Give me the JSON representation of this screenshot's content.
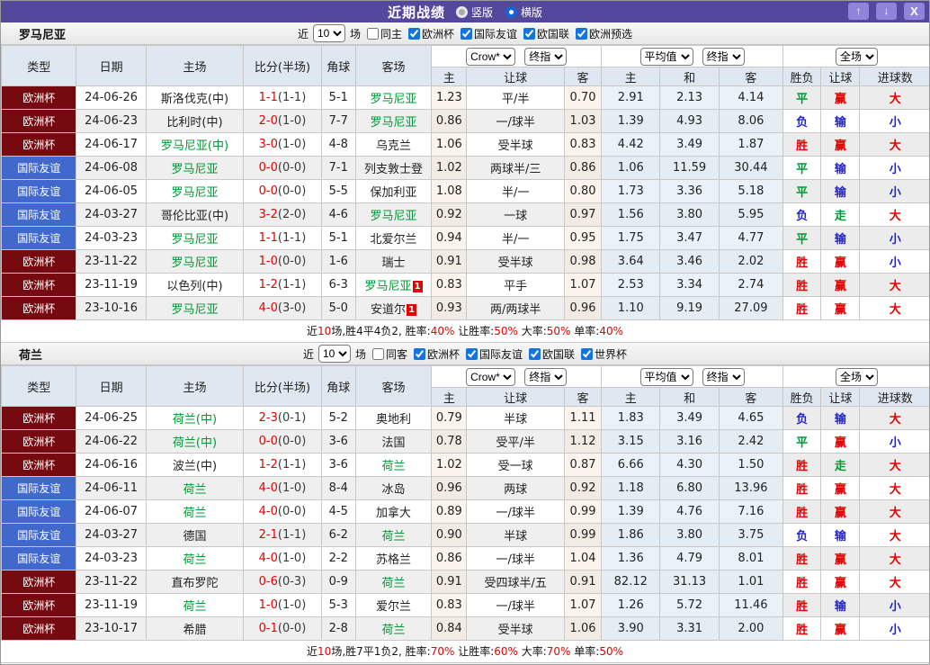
{
  "titlebar": {
    "title": "近期战绩",
    "radios": [
      {
        "label": "竖版",
        "selected": false
      },
      {
        "label": "横版",
        "selected": true
      }
    ],
    "buttons": {
      "up": "↑",
      "down": "↓",
      "close": "X"
    },
    "accent": "#54489C"
  },
  "labels": {
    "type": "类型",
    "date": "日期",
    "home": "主场",
    "score": "比分(半场)",
    "corner": "角球",
    "away": "客场",
    "odds_home": "主",
    "handicap": "让球",
    "odds_away": "客",
    "avg_home": "主",
    "avg_draw": "和",
    "avg_away": "客",
    "result": "胜负",
    "let_result": "让球",
    "goals": "进球数",
    "near": "近",
    "games": "场"
  },
  "colors": {
    "win": "#E60000",
    "draw": "#009933",
    "lose": "#2323CC",
    "cup_badge": "#750A10",
    "friendly_badge": "#4169CD",
    "self_team": "#009933"
  },
  "sections": [
    {
      "team": "罗马尼亚",
      "filter": {
        "count": "10",
        "same": "同主",
        "leagues": [
          "欧洲杯",
          "国际友谊",
          "欧国联",
          "欧洲预选"
        ]
      },
      "selects": {
        "crow": "Crow*",
        "crow_fin": "终指",
        "avg": "平均值",
        "avg_fin": "终指",
        "scope": "全场"
      },
      "rows": [
        {
          "league": "欧洲杯",
          "lt": "cup",
          "date": "24-06-26",
          "home": "斯洛伐克(中)",
          "hs": false,
          "score": "1-1",
          "half": "(1-1)",
          "corners": "5-1",
          "away": "罗马尼亚",
          "as": true,
          "card": "",
          "odds": [
            "1.23",
            "平/半",
            "0.70",
            "2.91",
            "2.13",
            "4.14"
          ],
          "results": [
            "平",
            "赢",
            "大"
          ]
        },
        {
          "league": "欧洲杯",
          "lt": "cup",
          "date": "24-06-23",
          "home": "比利时(中)",
          "hs": false,
          "score": "2-0",
          "half": "(1-0)",
          "corners": "7-7",
          "away": "罗马尼亚",
          "as": true,
          "card": "",
          "odds": [
            "0.86",
            "一/球半",
            "1.03",
            "1.39",
            "4.93",
            "8.06"
          ],
          "results": [
            "负",
            "输",
            "小"
          ]
        },
        {
          "league": "欧洲杯",
          "lt": "cup",
          "date": "24-06-17",
          "home": "罗马尼亚(中)",
          "hs": true,
          "score": "3-0",
          "half": "(1-0)",
          "corners": "4-8",
          "away": "乌克兰",
          "as": false,
          "card": "",
          "odds": [
            "1.06",
            "受半球",
            "0.83",
            "4.42",
            "3.49",
            "1.87"
          ],
          "results": [
            "胜",
            "赢",
            "大"
          ]
        },
        {
          "league": "国际友谊",
          "lt": "fr",
          "date": "24-06-08",
          "home": "罗马尼亚",
          "hs": true,
          "score": "0-0",
          "half": "(0-0)",
          "corners": "7-1",
          "away": "列支敦士登",
          "as": false,
          "card": "",
          "odds": [
            "1.02",
            "两球半/三",
            "0.86",
            "1.06",
            "11.59",
            "30.44"
          ],
          "results": [
            "平",
            "输",
            "小"
          ]
        },
        {
          "league": "国际友谊",
          "lt": "fr",
          "date": "24-06-05",
          "home": "罗马尼亚",
          "hs": true,
          "score": "0-0",
          "half": "(0-0)",
          "corners": "5-5",
          "away": "保加利亚",
          "as": false,
          "card": "",
          "odds": [
            "1.08",
            "半/一",
            "0.80",
            "1.73",
            "3.36",
            "5.18"
          ],
          "results": [
            "平",
            "输",
            "小"
          ]
        },
        {
          "league": "国际友谊",
          "lt": "fr",
          "date": "24-03-27",
          "home": "哥伦比亚(中)",
          "hs": false,
          "score": "3-2",
          "half": "(2-0)",
          "corners": "4-6",
          "away": "罗马尼亚",
          "as": true,
          "card": "",
          "odds": [
            "0.92",
            "一球",
            "0.97",
            "1.56",
            "3.80",
            "5.95"
          ],
          "results": [
            "负",
            "走",
            "大"
          ]
        },
        {
          "league": "国际友谊",
          "lt": "fr",
          "date": "24-03-23",
          "home": "罗马尼亚",
          "hs": true,
          "score": "1-1",
          "half": "(1-1)",
          "corners": "5-1",
          "away": "北爱尔兰",
          "as": false,
          "card": "",
          "odds": [
            "0.94",
            "半/一",
            "0.95",
            "1.75",
            "3.47",
            "4.77"
          ],
          "results": [
            "平",
            "输",
            "小"
          ]
        },
        {
          "league": "欧洲杯",
          "lt": "cup",
          "date": "23-11-22",
          "home": "罗马尼亚",
          "hs": true,
          "score": "1-0",
          "half": "(0-0)",
          "corners": "1-6",
          "away": "瑞士",
          "as": false,
          "card": "",
          "odds": [
            "0.91",
            "受半球",
            "0.98",
            "3.64",
            "3.46",
            "2.02"
          ],
          "results": [
            "胜",
            "赢",
            "小"
          ]
        },
        {
          "league": "欧洲杯",
          "lt": "cup",
          "date": "23-11-19",
          "home": "以色列(中)",
          "hs": false,
          "score": "1-2",
          "half": "(1-1)",
          "corners": "6-3",
          "away": "罗马尼亚",
          "as": true,
          "card": "1",
          "odds": [
            "0.83",
            "平手",
            "1.07",
            "2.53",
            "3.34",
            "2.74"
          ],
          "results": [
            "胜",
            "赢",
            "大"
          ]
        },
        {
          "league": "欧洲杯",
          "lt": "cup",
          "date": "23-10-16",
          "home": "罗马尼亚",
          "hs": true,
          "score": "4-0",
          "half": "(3-0)",
          "corners": "5-0",
          "away": "安道尔",
          "as": false,
          "card": "1",
          "odds": [
            "0.93",
            "两/两球半",
            "0.96",
            "1.10",
            "9.19",
            "27.09"
          ],
          "results": [
            "胜",
            "赢",
            "大"
          ]
        }
      ],
      "summary": [
        {
          "t": "近",
          "red": false
        },
        {
          "t": "10",
          "red": true
        },
        {
          "t": "场,胜4平4负2, 胜率:",
          "red": false
        },
        {
          "t": "40%",
          "red": true
        },
        {
          "t": " 让胜率:",
          "red": false
        },
        {
          "t": "50%",
          "red": true
        },
        {
          "t": " 大率:",
          "red": false
        },
        {
          "t": "50%",
          "red": true
        },
        {
          "t": " 单率:",
          "red": false
        },
        {
          "t": "40%",
          "red": true
        }
      ]
    },
    {
      "team": "荷兰",
      "filter": {
        "count": "10",
        "same": "同客",
        "leagues": [
          "欧洲杯",
          "国际友谊",
          "欧国联",
          "世界杯"
        ]
      },
      "selects": {
        "crow": "Crow*",
        "crow_fin": "终指",
        "avg": "平均值",
        "avg_fin": "终指",
        "scope": "全场"
      },
      "rows": [
        {
          "league": "欧洲杯",
          "lt": "cup",
          "date": "24-06-25",
          "home": "荷兰(中)",
          "hs": true,
          "score": "2-3",
          "half": "(0-1)",
          "corners": "5-2",
          "away": "奥地利",
          "as": false,
          "card": "",
          "odds": [
            "0.79",
            "半球",
            "1.11",
            "1.83",
            "3.49",
            "4.65"
          ],
          "results": [
            "负",
            "输",
            "大"
          ]
        },
        {
          "league": "欧洲杯",
          "lt": "cup",
          "date": "24-06-22",
          "home": "荷兰(中)",
          "hs": true,
          "score": "0-0",
          "half": "(0-0)",
          "corners": "3-6",
          "away": "法国",
          "as": false,
          "card": "",
          "odds": [
            "0.78",
            "受平/半",
            "1.12",
            "3.15",
            "3.16",
            "2.42"
          ],
          "results": [
            "平",
            "赢",
            "小"
          ]
        },
        {
          "league": "欧洲杯",
          "lt": "cup",
          "date": "24-06-16",
          "home": "波兰(中)",
          "hs": false,
          "score": "1-2",
          "half": "(1-1)",
          "corners": "3-6",
          "away": "荷兰",
          "as": true,
          "card": "",
          "odds": [
            "1.02",
            "受一球",
            "0.87",
            "6.66",
            "4.30",
            "1.50"
          ],
          "results": [
            "胜",
            "走",
            "大"
          ]
        },
        {
          "league": "国际友谊",
          "lt": "fr",
          "date": "24-06-11",
          "home": "荷兰",
          "hs": true,
          "score": "4-0",
          "half": "(1-0)",
          "corners": "8-4",
          "away": "冰岛",
          "as": false,
          "card": "",
          "odds": [
            "0.96",
            "两球",
            "0.92",
            "1.18",
            "6.80",
            "13.96"
          ],
          "results": [
            "胜",
            "赢",
            "大"
          ]
        },
        {
          "league": "国际友谊",
          "lt": "fr",
          "date": "24-06-07",
          "home": "荷兰",
          "hs": true,
          "score": "4-0",
          "half": "(0-0)",
          "corners": "4-5",
          "away": "加拿大",
          "as": false,
          "card": "",
          "odds": [
            "0.89",
            "一/球半",
            "0.99",
            "1.39",
            "4.76",
            "7.16"
          ],
          "results": [
            "胜",
            "赢",
            "大"
          ]
        },
        {
          "league": "国际友谊",
          "lt": "fr",
          "date": "24-03-27",
          "home": "德国",
          "hs": false,
          "score": "2-1",
          "half": "(1-1)",
          "corners": "6-2",
          "away": "荷兰",
          "as": true,
          "card": "",
          "odds": [
            "0.90",
            "半球",
            "0.99",
            "1.86",
            "3.80",
            "3.75"
          ],
          "results": [
            "负",
            "输",
            "大"
          ]
        },
        {
          "league": "国际友谊",
          "lt": "fr",
          "date": "24-03-23",
          "home": "荷兰",
          "hs": true,
          "score": "4-0",
          "half": "(1-0)",
          "corners": "2-2",
          "away": "苏格兰",
          "as": false,
          "card": "",
          "odds": [
            "0.86",
            "一/球半",
            "1.04",
            "1.36",
            "4.79",
            "8.01"
          ],
          "results": [
            "胜",
            "赢",
            "大"
          ]
        },
        {
          "league": "欧洲杯",
          "lt": "cup",
          "date": "23-11-22",
          "home": "直布罗陀",
          "hs": false,
          "score": "0-6",
          "half": "(0-3)",
          "corners": "0-9",
          "away": "荷兰",
          "as": true,
          "card": "",
          "odds": [
            "0.91",
            "受四球半/五",
            "0.91",
            "82.12",
            "31.13",
            "1.01"
          ],
          "results": [
            "胜",
            "赢",
            "大"
          ]
        },
        {
          "league": "欧洲杯",
          "lt": "cup",
          "date": "23-11-19",
          "home": "荷兰",
          "hs": true,
          "score": "1-0",
          "half": "(1-0)",
          "corners": "5-3",
          "away": "爱尔兰",
          "as": false,
          "card": "",
          "odds": [
            "0.83",
            "一/球半",
            "1.07",
            "1.26",
            "5.72",
            "11.46"
          ],
          "results": [
            "胜",
            "输",
            "小"
          ]
        },
        {
          "league": "欧洲杯",
          "lt": "cup",
          "date": "23-10-17",
          "home": "希腊",
          "hs": false,
          "score": "0-1",
          "half": "(0-0)",
          "corners": "2-8",
          "away": "荷兰",
          "as": true,
          "card": "",
          "odds": [
            "0.84",
            "受半球",
            "1.06",
            "3.90",
            "3.31",
            "2.00"
          ],
          "results": [
            "胜",
            "赢",
            "小"
          ]
        }
      ],
      "summary": [
        {
          "t": "近",
          "red": false
        },
        {
          "t": "10",
          "red": true
        },
        {
          "t": "场,胜7平1负2, 胜率:",
          "red": false
        },
        {
          "t": "70%",
          "red": true
        },
        {
          "t": " 让胜率:",
          "red": false
        },
        {
          "t": "60%",
          "red": true
        },
        {
          "t": " 大率:",
          "red": false
        },
        {
          "t": "70%",
          "red": true
        },
        {
          "t": " 单率:",
          "red": false
        },
        {
          "t": "50%",
          "red": true
        }
      ]
    }
  ]
}
